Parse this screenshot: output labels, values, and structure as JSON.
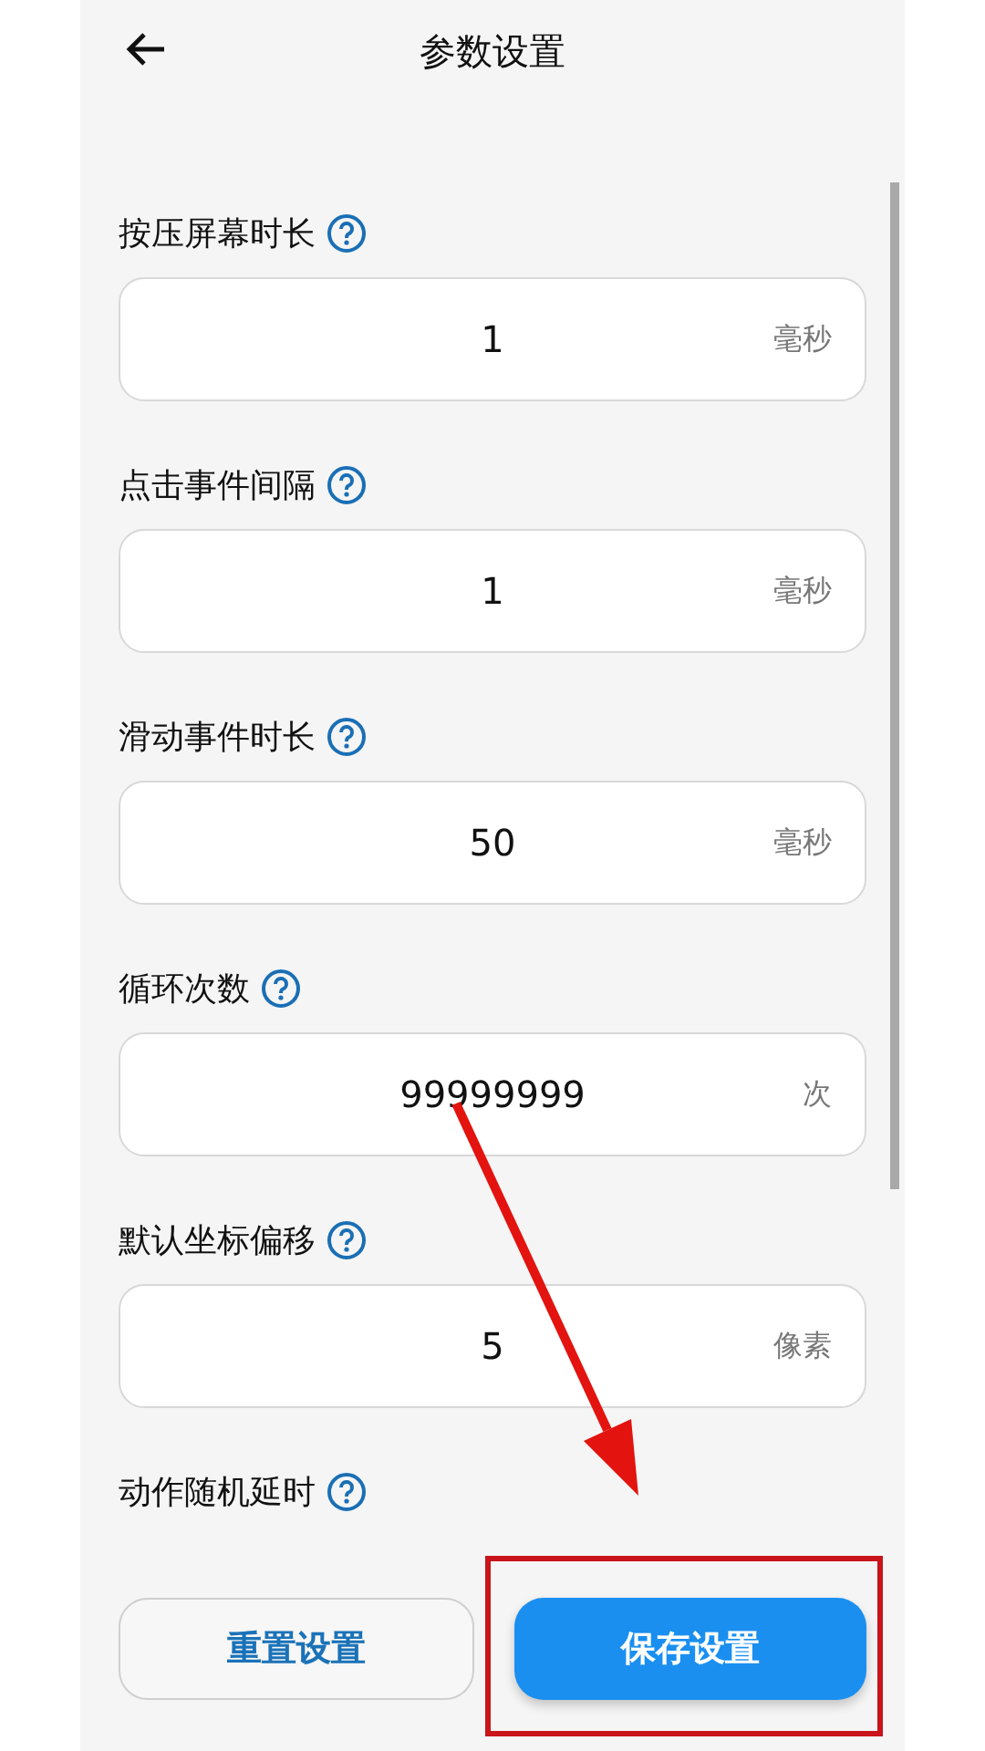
{
  "header": {
    "title": "参数设置"
  },
  "settings": [
    {
      "kind": "input",
      "label": "按压屏幕时长",
      "value": "1",
      "unit": "毫秒"
    },
    {
      "kind": "input",
      "label": "点击事件间隔",
      "value": "1",
      "unit": "毫秒"
    },
    {
      "kind": "input",
      "label": "滑动事件时长",
      "value": "50",
      "unit": "毫秒"
    },
    {
      "kind": "input",
      "label": "循环次数",
      "value": "99999999",
      "unit": "次"
    },
    {
      "kind": "input",
      "label": "默认坐标偏移",
      "value": "5",
      "unit": "像素"
    },
    {
      "kind": "heading",
      "label": "动作随机延时"
    }
  ],
  "buttons": [
    {
      "kind": "outline",
      "label": "重置设置"
    },
    {
      "kind": "primary",
      "label": "保存设置"
    }
  ],
  "annotations": {
    "arrow": true,
    "frame": true
  }
}
